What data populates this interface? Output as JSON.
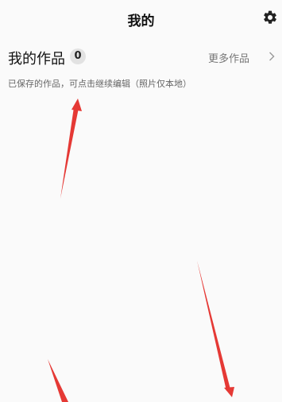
{
  "header": {
    "title": "我的",
    "settings_icon": "gear-icon"
  },
  "works": {
    "title": "我的作品",
    "count": "0",
    "more_label": "更多作品",
    "more_icon": "chevron-right-icon",
    "hint": "已保存的作品，可点击继续编辑（照片仅本地）"
  },
  "annotations": {
    "arrow_color": "#e53935"
  }
}
